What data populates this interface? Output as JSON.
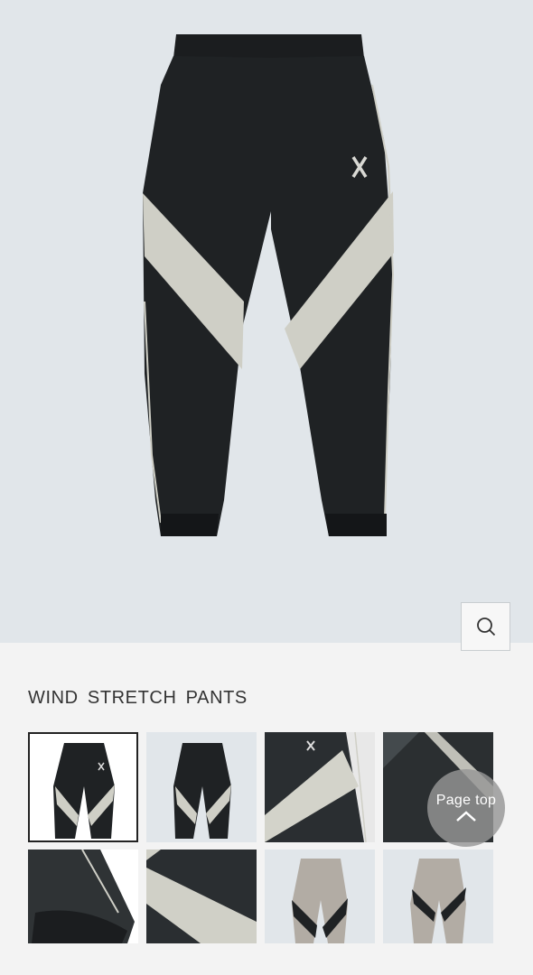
{
  "product": {
    "title": "WIND STRETCH PANTS"
  },
  "controls": {
    "zoom_icon": "magnifier-icon",
    "page_top_label": "Page top",
    "page_top_icon": "chevron-up-icon"
  },
  "gallery": {
    "thumbnails": [
      {
        "id": 1,
        "view": "front-dark",
        "selected": true
      },
      {
        "id": 2,
        "view": "back-dark",
        "selected": false
      },
      {
        "id": 3,
        "view": "detail-logo",
        "selected": false
      },
      {
        "id": 4,
        "view": "detail-panel",
        "selected": false
      },
      {
        "id": 5,
        "view": "detail-cuff",
        "selected": false
      },
      {
        "id": 6,
        "view": "detail-stripe",
        "selected": false
      },
      {
        "id": 7,
        "view": "front-grey",
        "selected": false
      },
      {
        "id": 8,
        "view": "back-grey",
        "selected": false
      }
    ]
  },
  "colors": {
    "hero_bg": "#e1e6ea",
    "page_bg": "#f3f3f3",
    "pants_black": "#1f2224",
    "stripe_cream": "#cfcfc6",
    "pants_grey": "#b2aca4"
  }
}
